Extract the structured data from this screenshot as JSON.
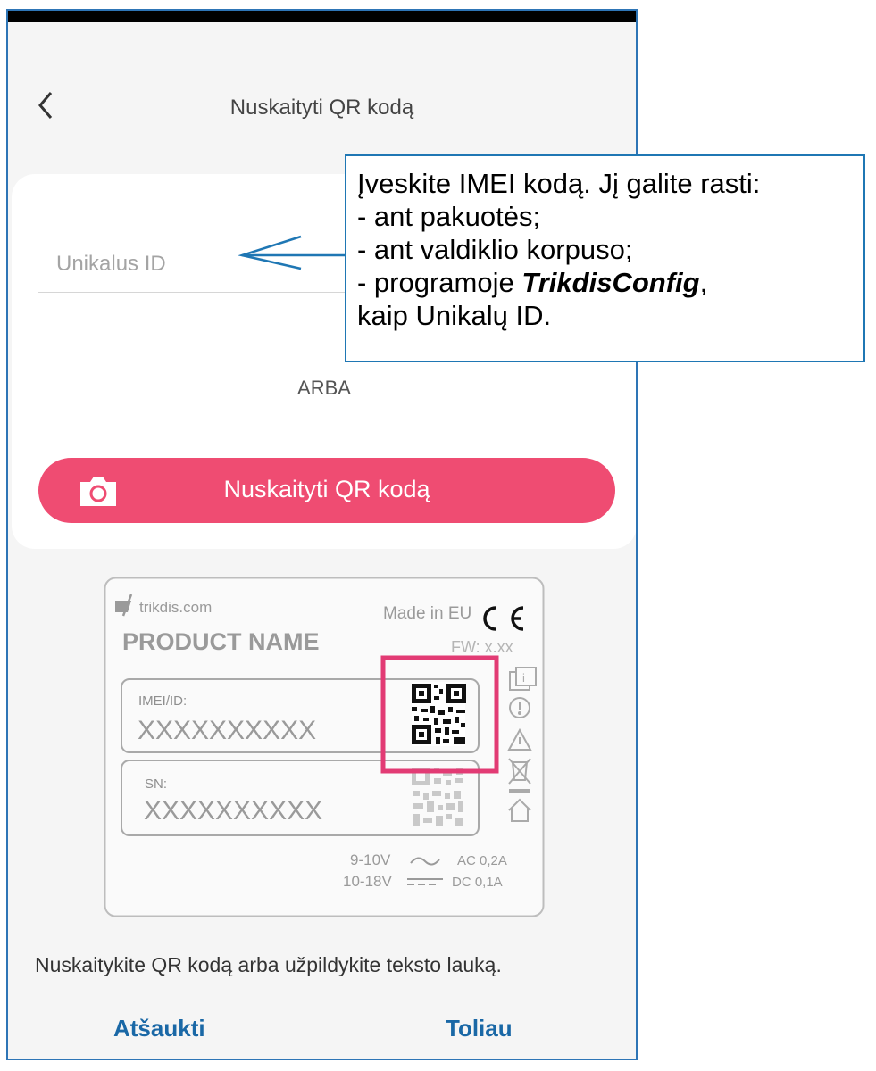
{
  "header": {
    "title": "Nuskaityti QR kodą"
  },
  "form": {
    "id_placeholder": "Unikalus ID",
    "or_label": "ARBA",
    "scan_button_label": "Nuskaityti QR kodą"
  },
  "device_label": {
    "brand": "trikdis.com",
    "product_name": "PRODUCT NAME",
    "made_in": "Made in EU",
    "ce_mark": "CE",
    "fw": "FW: x.xx",
    "imei_label": "IMEI/ID:",
    "imei_value": "XXXXXXXXXX",
    "sn_label": "SN:",
    "sn_value": "XXXXXXXXXX",
    "ac_voltage": "9-10V",
    "ac_rating": "AC 0,2A",
    "dc_voltage": "10-18V",
    "dc_rating": "DC 0,1A"
  },
  "hint": "Nuskaitykite QR kodą arba užpildykite teksto lauką.",
  "actions": {
    "cancel": "Atšaukti",
    "next": "Toliau"
  },
  "callout": {
    "line1": "Įveskite IMEI kodą. Jį galite rasti:",
    "line2": "- ant pakuotės;",
    "line3": "- ant valdiklio korpuso;",
    "line4_prefix": "- programoje ",
    "line4_app": "TrikdisConfig",
    "line4_suffix": ",",
    "line5": "kaip Unikalų ID."
  },
  "colors": {
    "accent": "#ef4c72",
    "link": "#1a68a6",
    "callout_border": "#1f77b4",
    "qr_highlight": "#e23b74"
  }
}
